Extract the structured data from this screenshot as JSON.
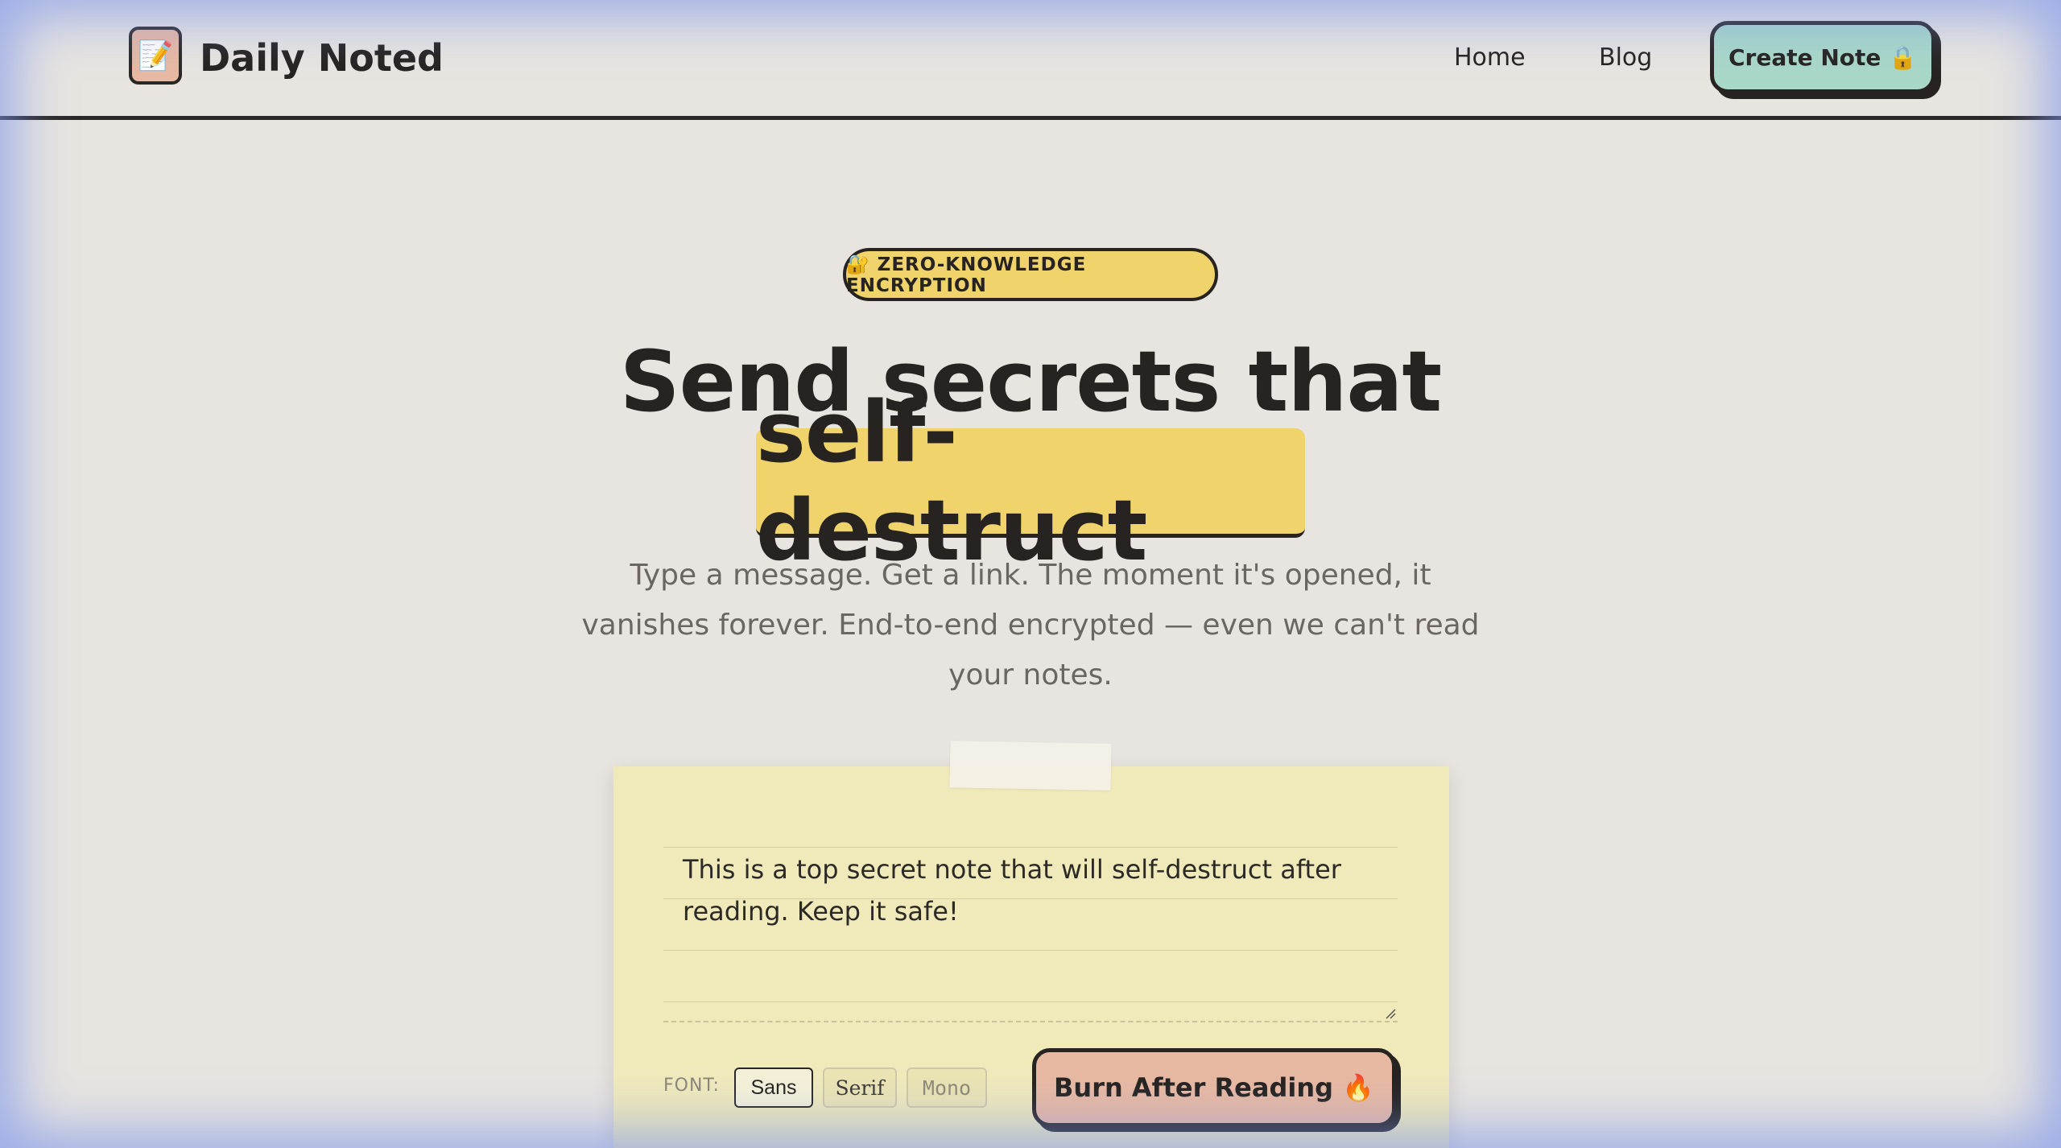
{
  "header": {
    "logo_icon": "✏️📝",
    "brand": "Daily Noted",
    "nav": {
      "home": "Home",
      "blog": "Blog"
    },
    "cta": "Create Note 🔒"
  },
  "hero": {
    "badge": "🔐 ZERO-KNOWLEDGE ENCRYPTION",
    "title_line1": "Send secrets that",
    "title_highlight": "self-destruct",
    "subtitle": "Type a message. Get a link. The moment it's opened, it vanishes forever. End-to-end encrypted — even we can't read your notes."
  },
  "note": {
    "text": "This is a top secret note that will self-destruct after reading. Keep it safe!",
    "font_label": "FONT:",
    "fonts": [
      "Sans",
      "Serif",
      "Mono"
    ],
    "selected_font": "Sans",
    "submit": "Burn After Reading 🔥"
  },
  "colors": {
    "accent_yellow": "#f0d36a",
    "accent_mint": "#a9d8c8",
    "accent_peach": "#e8b9a2",
    "note_paper": "#f0eabb"
  }
}
